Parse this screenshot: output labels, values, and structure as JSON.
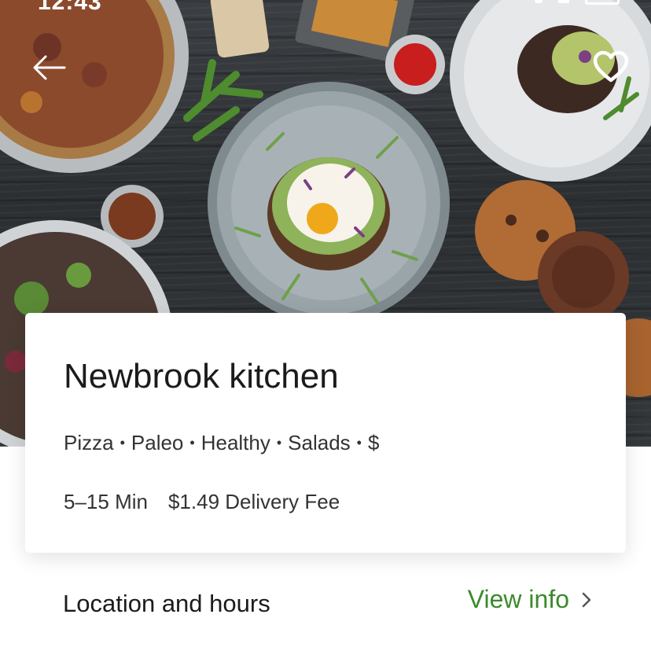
{
  "status_bar": {
    "time": "12:43"
  },
  "header": {
    "back_icon": "arrow-left-icon",
    "favorite_icon": "heart-outline-icon"
  },
  "store": {
    "name": "Newbrook kitchen",
    "categories": [
      "Pizza",
      "Paleo",
      "Healthy",
      "Salads",
      "$"
    ],
    "separator": "•",
    "eta": "5–15 Min",
    "delivery_fee": "$1.49 Delivery Fee"
  },
  "location": {
    "label": "Location and hours",
    "link_label": "View info",
    "link_icon": "chevron-right-icon"
  },
  "colors": {
    "accent_green": "#3b8a2a",
    "text_primary": "#1b1b1b",
    "text_secondary": "#333333"
  }
}
